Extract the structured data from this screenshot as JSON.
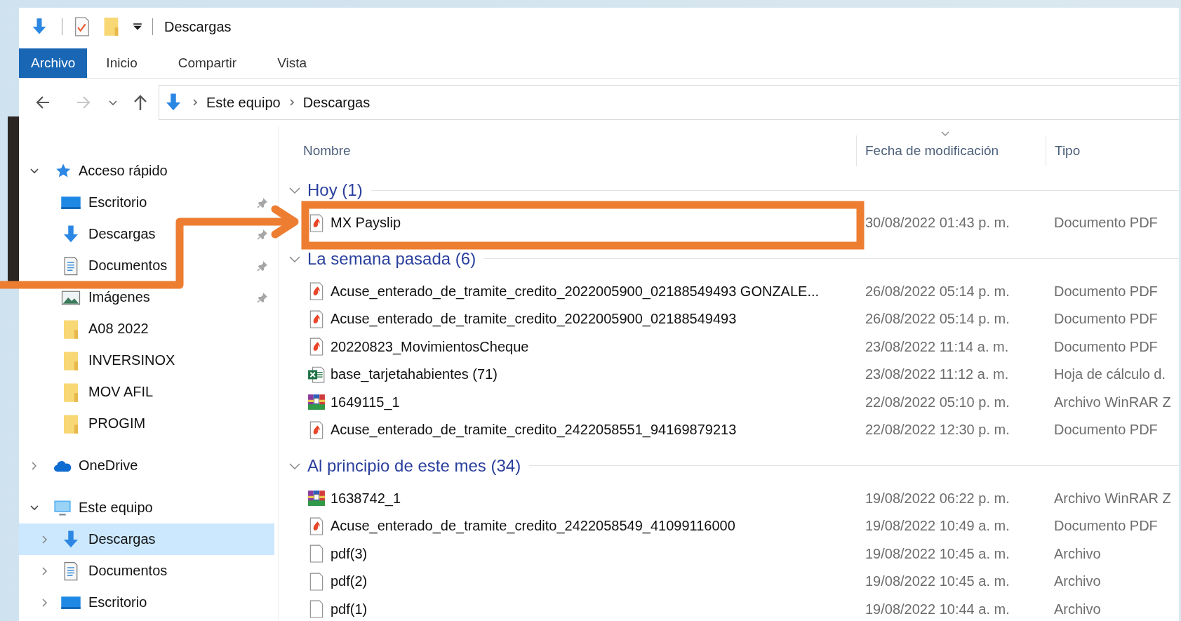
{
  "window": {
    "title": "Descargas"
  },
  "ribbon_tabs": [
    {
      "label": "Archivo",
      "selected": true
    },
    {
      "label": "Inicio",
      "selected": false
    },
    {
      "label": "Compartir",
      "selected": false
    },
    {
      "label": "Vista",
      "selected": false
    }
  ],
  "nav_buttons": {
    "back": {
      "disabled": false
    },
    "forward": {
      "disabled": true
    }
  },
  "address_bar": {
    "path": [
      "Este equipo",
      "Descargas"
    ]
  },
  "sidebar": {
    "items": [
      {
        "label": "Acceso rápido",
        "kind": "quick-access",
        "expanded": true,
        "selected": false,
        "children": [
          {
            "label": "Escritorio",
            "kind": "desktop",
            "pinned": true,
            "selected": false
          },
          {
            "label": "Descargas",
            "kind": "download",
            "pinned": true,
            "selected": false
          },
          {
            "label": "Documentos",
            "kind": "documents",
            "pinned": true,
            "selected": false
          },
          {
            "label": "Imágenes",
            "kind": "pictures",
            "pinned": true,
            "selected": false
          },
          {
            "label": "A08 2022",
            "kind": "folder",
            "pinned": false,
            "selected": false
          },
          {
            "label": "INVERSINOX",
            "kind": "folder",
            "pinned": false,
            "selected": false
          },
          {
            "label": "MOV AFIL",
            "kind": "folder",
            "pinned": false,
            "selected": false
          },
          {
            "label": "PROGIM",
            "kind": "folder",
            "pinned": false,
            "selected": false
          }
        ]
      },
      {
        "label": "OneDrive",
        "kind": "onedrive",
        "expanded": false,
        "selected": false
      },
      {
        "label": "Este equipo",
        "kind": "pc",
        "expanded": true,
        "selected": false,
        "children": [
          {
            "label": "Descargas",
            "kind": "download",
            "expanded": false,
            "selected": true
          },
          {
            "label": "Documentos",
            "kind": "documents",
            "expanded": false,
            "selected": false
          },
          {
            "label": "Escritorio",
            "kind": "desktop",
            "expanded": false,
            "selected": false
          }
        ]
      }
    ]
  },
  "file_list": {
    "columns": [
      {
        "label": "Nombre",
        "sorted": false
      },
      {
        "label": "Fecha de modificación",
        "sorted": true
      },
      {
        "label": "Tipo",
        "sorted": false
      }
    ],
    "groups": [
      {
        "title": "Hoy (1)",
        "expanded": true,
        "files": [
          {
            "name": "MX Payslip",
            "kind": "pdf",
            "modified": "30/08/2022 01:43 p. m.",
            "type": "Documento PDF"
          }
        ]
      },
      {
        "title": "La semana pasada (6)",
        "expanded": true,
        "files": [
          {
            "name": "Acuse_enterado_de_tramite_credito_2022005900_02188549493 GONZALE...",
            "kind": "pdf",
            "modified": "26/08/2022 05:14 p. m.",
            "type": "Documento PDF"
          },
          {
            "name": "Acuse_enterado_de_tramite_credito_2022005900_02188549493",
            "kind": "pdf",
            "modified": "26/08/2022 05:14 p. m.",
            "type": "Documento PDF"
          },
          {
            "name": "20220823_MovimientosCheque",
            "kind": "pdf",
            "modified": "23/08/2022 11:14 a. m.",
            "type": "Documento PDF"
          },
          {
            "name": "base_tarjetahabientes (71)",
            "kind": "excel",
            "modified": "23/08/2022 11:12 a. m.",
            "type": "Hoja de cálculo d."
          },
          {
            "name": "1649115_1",
            "kind": "rar",
            "modified": "22/08/2022 05:10 p. m.",
            "type": "Archivo WinRAR Z"
          },
          {
            "name": "Acuse_enterado_de_tramite_credito_2422058551_94169879213",
            "kind": "pdf",
            "modified": "22/08/2022 12:30 p. m.",
            "type": "Documento PDF"
          }
        ]
      },
      {
        "title": "Al principio de este mes (34)",
        "expanded": true,
        "files": [
          {
            "name": "1638742_1",
            "kind": "rar",
            "modified": "19/08/2022 06:22 p. m.",
            "type": "Archivo WinRAR Z"
          },
          {
            "name": "Acuse_enterado_de_tramite_credito_2422058549_41099116000",
            "kind": "pdf",
            "modified": "19/08/2022 10:49 a. m.",
            "type": "Documento PDF"
          },
          {
            "name": "pdf(3)",
            "kind": "blank",
            "modified": "19/08/2022 10:45 a. m.",
            "type": "Archivo"
          },
          {
            "name": "pdf(2)",
            "kind": "blank",
            "modified": "19/08/2022 10:45 a. m.",
            "type": "Archivo"
          },
          {
            "name": "pdf(1)",
            "kind": "blank",
            "modified": "19/08/2022 10:44 a. m.",
            "type": "Archivo"
          }
        ]
      }
    ]
  }
}
